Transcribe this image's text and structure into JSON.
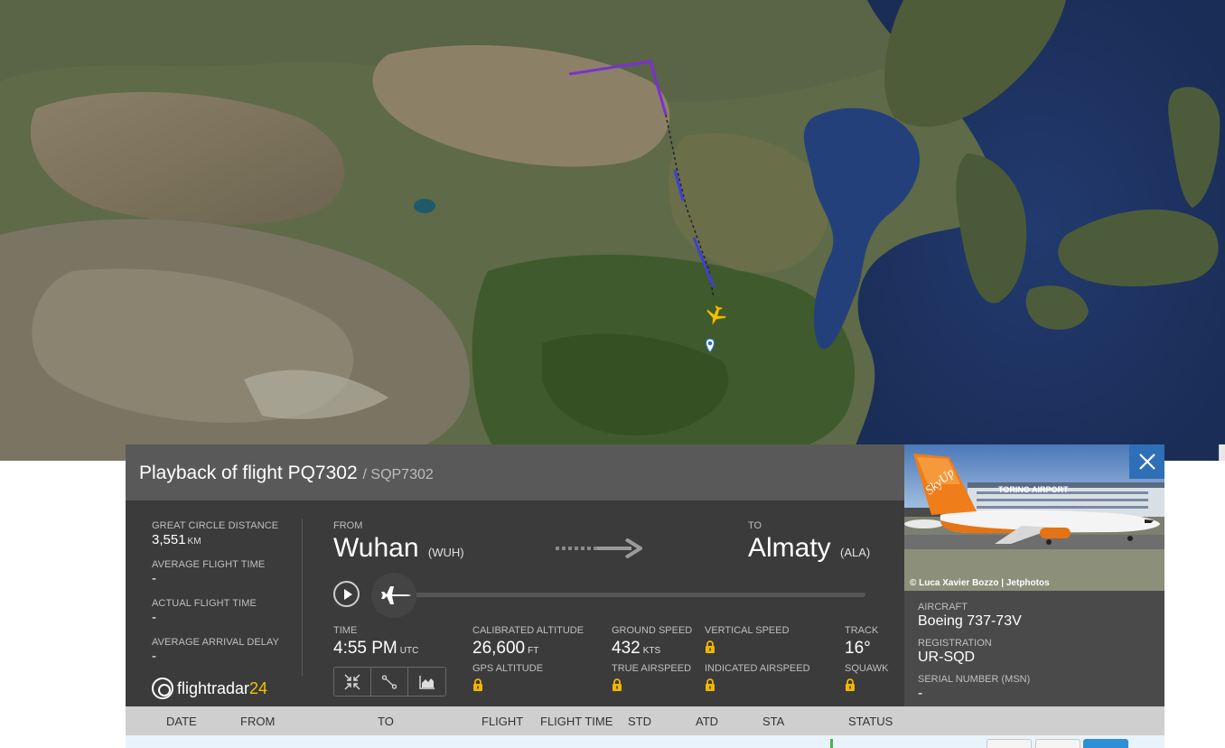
{
  "flight": {
    "title": "Playback of flight PQ7302",
    "callsign": "/ SQP7302"
  },
  "stats": {
    "great_circle_label": "GREAT CIRCLE DISTANCE",
    "great_circle_value": "3,551",
    "great_circle_unit": "KM",
    "avg_flight_time_label": "AVERAGE FLIGHT TIME",
    "avg_flight_time_value": "-",
    "actual_flight_time_label": "ACTUAL FLIGHT TIME",
    "actual_flight_time_value": "-",
    "avg_arrival_delay_label": "AVERAGE ARRIVAL DELAY",
    "avg_arrival_delay_value": "-"
  },
  "logo": {
    "text": "flightradar",
    "num": "24"
  },
  "route": {
    "from_label": "FROM",
    "from_city": "Wuhan",
    "from_code": "(WUH)",
    "to_label": "TO",
    "to_city": "Almaty",
    "to_code": "(ALA)"
  },
  "playback": {
    "progress": 0.0
  },
  "metrics": {
    "time_label": "TIME",
    "time_value": "4:55 PM",
    "time_unit": "UTC",
    "cal_alt_label": "CALIBRATED ALTITUDE",
    "cal_alt_value": "26,600",
    "cal_alt_unit": "FT",
    "gps_alt_label": "GPS ALTITUDE",
    "ground_speed_label": "GROUND SPEED",
    "ground_speed_value": "432",
    "ground_speed_unit": "KTS",
    "true_airspeed_label": "TRUE AIRSPEED",
    "vertical_speed_label": "VERTICAL SPEED",
    "indicated_airspeed_label": "INDICATED AIRSPEED",
    "track_label": "TRACK",
    "track_value": "16°",
    "squawk_label": "SQUAWK"
  },
  "aircraft": {
    "photo_credit": "© Luca Xavier Bozzo | Jetphotos",
    "photo_airline": "SkyUp",
    "photo_airport_sign": "TORINO AIRPORT",
    "aircraft_label": "AIRCRAFT",
    "aircraft_value": "Boeing 737-73V",
    "registration_label": "REGISTRATION",
    "registration_value": "UR-SQD",
    "serial_label": "SERIAL NUMBER (MSN)",
    "serial_value": "-"
  },
  "table": {
    "columns": [
      "DATE",
      "FROM",
      "TO",
      "FLIGHT",
      "FLIGHT TIME",
      "STD",
      "ATD",
      "STA",
      "STATUS"
    ]
  },
  "colors": {
    "track_purple": "#7b2fd6",
    "track_blue": "#3f3fd9",
    "plane_yellow": "#f2c200",
    "close_blue": "#2e6fb7",
    "lock_yellow": "#f2b600"
  },
  "icons": {
    "close": "close-icon",
    "play": "play-icon",
    "plane": "airplane-icon",
    "lock": "lock-icon"
  }
}
